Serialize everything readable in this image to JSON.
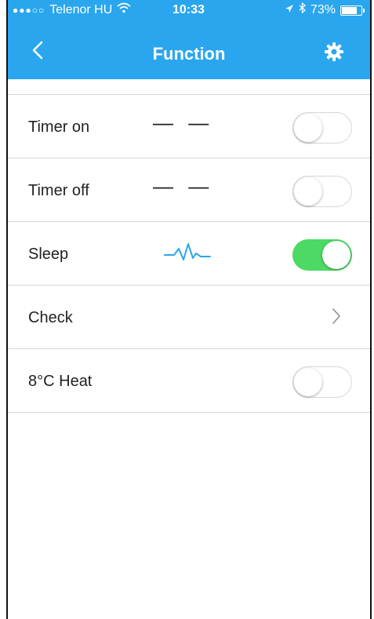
{
  "status_bar": {
    "carrier": "Telenor HU",
    "time": "10:33",
    "battery": "73%",
    "battery_level": 0.73,
    "signal_dots": "●●●○○"
  },
  "nav": {
    "title": "Function",
    "back_icon": "chevron-left-icon",
    "settings_icon": "gear-icon"
  },
  "rows": [
    {
      "label": "Timer on",
      "value": "— —",
      "toggle_on": false
    },
    {
      "label": "Timer off",
      "value": "— —",
      "toggle_on": false
    },
    {
      "label": "Sleep",
      "value_icon": "sleep-wave-icon",
      "toggle_on": true
    },
    {
      "label": "Check",
      "control": "chevron-right-icon"
    },
    {
      "label": "8°C Heat",
      "toggle_on": false
    }
  ],
  "colors": {
    "header": "#2aa6ee",
    "toggle_on": "#4cd964",
    "sleep_icon": "#2aa6ee"
  }
}
